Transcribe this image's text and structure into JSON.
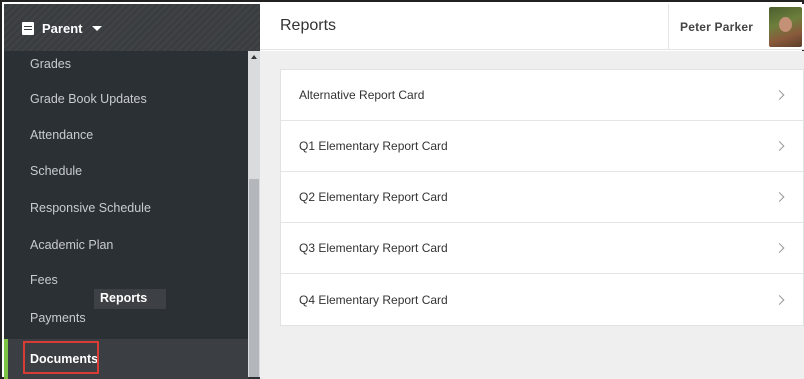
{
  "header": {
    "role_label": "Parent",
    "page_title": "Reports",
    "user_name": "Peter Parker"
  },
  "sidebar": {
    "items": [
      {
        "label": "Grades"
      },
      {
        "label": "Grade Book Updates"
      },
      {
        "label": "Attendance"
      },
      {
        "label": "Schedule"
      },
      {
        "label": "Responsive Schedule"
      },
      {
        "label": "Academic Plan"
      },
      {
        "label": "Fees"
      },
      {
        "label": "Payments"
      },
      {
        "label": "Documents",
        "active": true
      }
    ],
    "tooltip": "Reports"
  },
  "reports": {
    "items": [
      {
        "label": "Alternative Report Card"
      },
      {
        "label": "Q1 Elementary Report Card"
      },
      {
        "label": "Q2 Elementary Report Card"
      },
      {
        "label": "Q3 Elementary Report Card"
      },
      {
        "label": "Q4 Elementary Report Card"
      }
    ]
  },
  "colors": {
    "sidebar_bg": "#2b3034",
    "active_accent": "#7cc243",
    "highlight": "#d93b35",
    "content_bg": "#efeff0"
  }
}
